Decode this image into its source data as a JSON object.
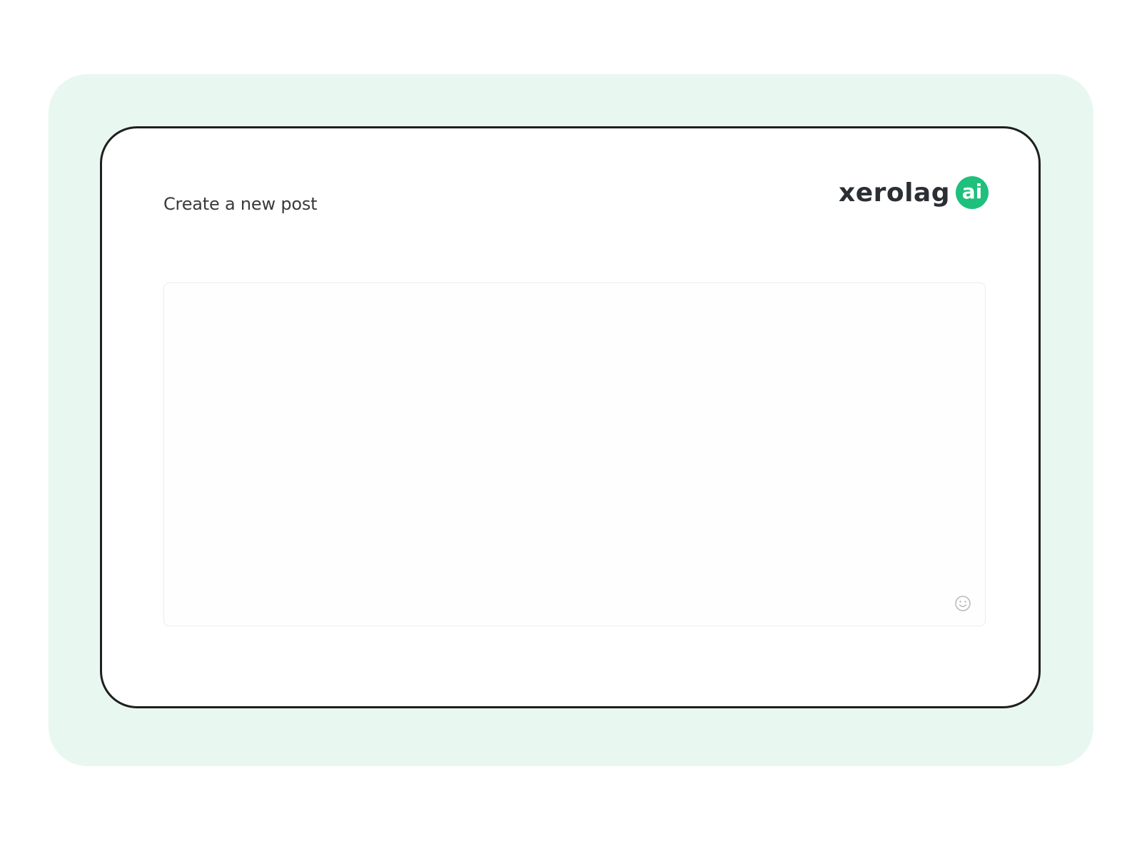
{
  "header": {
    "title": "Create a new post"
  },
  "brand": {
    "wordmark": "xerolag",
    "badge": "ai",
    "accent_color": "#1fbf7c"
  },
  "composer": {
    "value": "",
    "placeholder": "",
    "emoji_icon": "smiley-icon"
  },
  "colors": {
    "panel_background": "#e8f8f1",
    "frame_border": "#1f1f1f"
  }
}
